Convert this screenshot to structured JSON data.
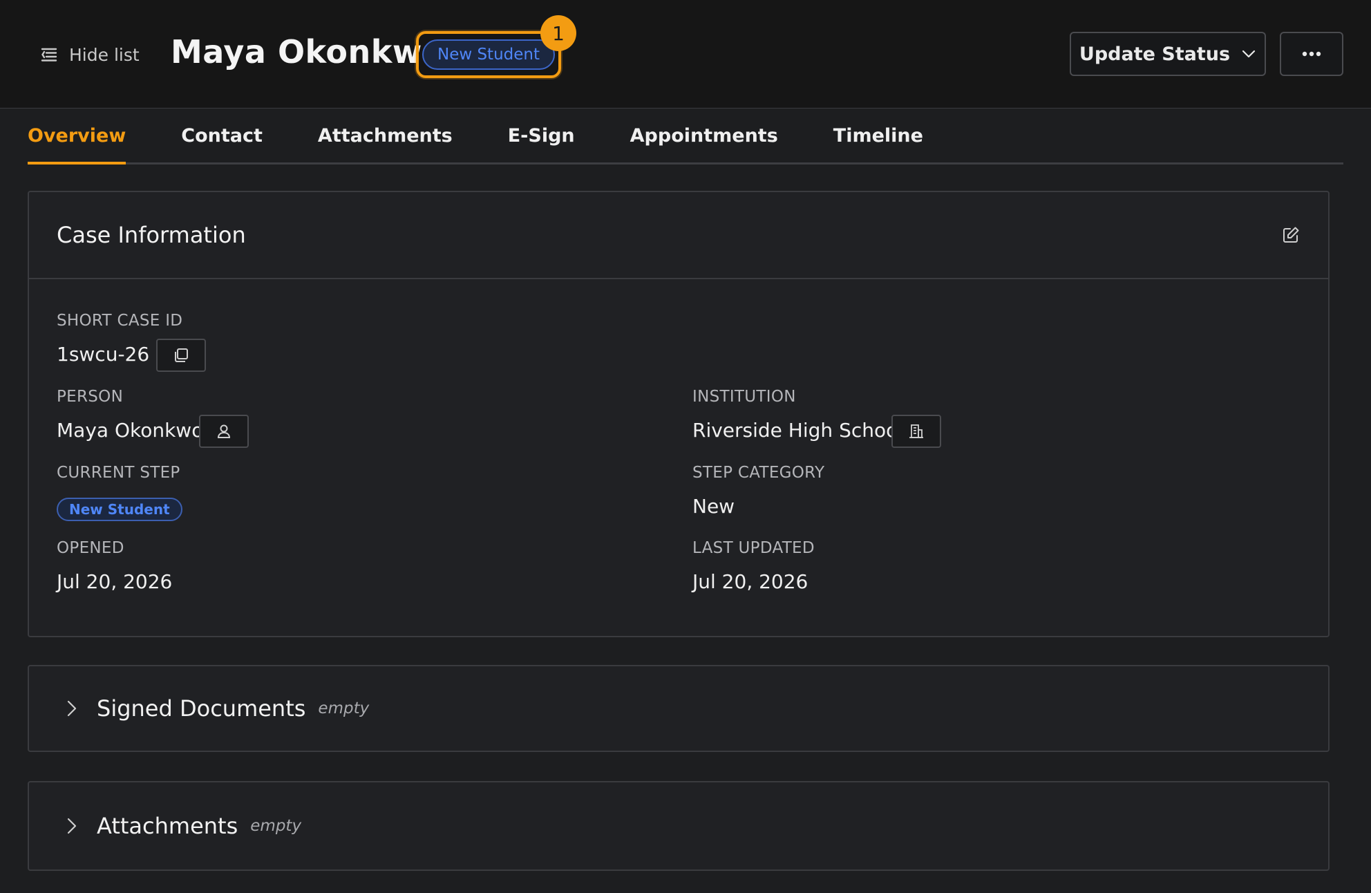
{
  "header": {
    "hide_list_label": "Hide list",
    "person_name": "Maya Okonkwo",
    "status_badge": "New Student",
    "status_count": "1",
    "update_status_label": "Update Status",
    "more_icon": "ellipsis-icon",
    "accent_color": "#f39c12"
  },
  "tabs": [
    {
      "label": "Overview",
      "active": true
    },
    {
      "label": "Contact",
      "active": false
    },
    {
      "label": "Attachments",
      "active": false
    },
    {
      "label": "E-Sign",
      "active": false
    },
    {
      "label": "Appointments",
      "active": false
    },
    {
      "label": "Timeline",
      "active": false
    }
  ],
  "case_info": {
    "title": "Case Information",
    "short_case_id_label": "SHORT CASE ID",
    "short_case_id": "1swcu-26",
    "person_label": "PERSON",
    "person": "Maya Okonkwo",
    "institution_label": "INSTITUTION",
    "institution": "Riverside High School",
    "current_step_label": "CURRENT STEP",
    "current_step": "New Student",
    "step_category_label": "STEP CATEGORY",
    "step_category": "New",
    "opened_label": "OPENED",
    "opened": "Jul 20, 2026",
    "last_updated_label": "LAST UPDATED",
    "last_updated": "Jul 20, 2026"
  },
  "signed_documents": {
    "title": "Signed Documents",
    "meta": "empty"
  },
  "attachments": {
    "title": "Attachments",
    "meta": "empty"
  }
}
